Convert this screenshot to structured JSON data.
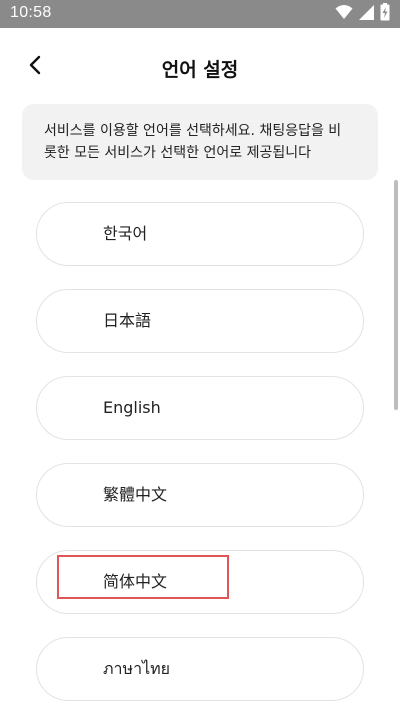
{
  "status_bar": {
    "time": "10:58",
    "icons": [
      "wifi-icon",
      "signal-icon",
      "battery-charging-icon"
    ]
  },
  "header": {
    "back_icon": "chevron-left-icon",
    "title": "언어 설정"
  },
  "info": {
    "line1": "서비스를 이용할 언어를 선택하세요. 채팅응답을 비",
    "line2": "롯한 모든 서비스가 선택한 언어로 제공됩니다"
  },
  "languages": [
    {
      "label": "한국어"
    },
    {
      "label": "日本語"
    },
    {
      "label": "English"
    },
    {
      "label": "繁體中文"
    },
    {
      "label": "简体中文",
      "highlighted": true
    },
    {
      "label": "ภาษาไทย"
    }
  ],
  "colors": {
    "status_bar": "#8a8a8a",
    "info_bg": "#f2f2f2",
    "highlight": "#e05555",
    "pill_border": "#e3e3e3"
  }
}
